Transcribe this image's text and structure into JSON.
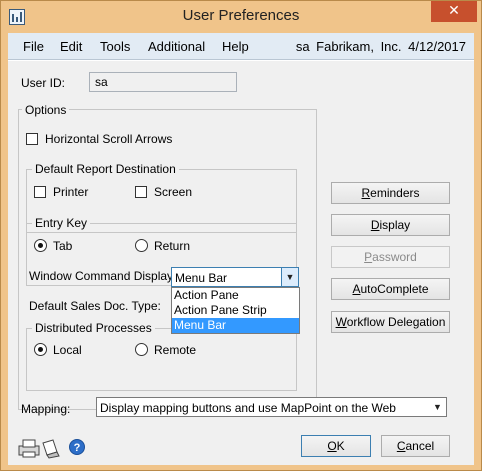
{
  "window": {
    "title": "User Preferences",
    "close_glyph": "✕",
    "icon": "app-window-icon"
  },
  "menubar": {
    "items": [
      "File",
      "Edit",
      "Tools",
      "Additional",
      "Help"
    ],
    "user": "sa",
    "company": "Fabrikam, Inc.",
    "date": "4/12/2017"
  },
  "user_id": {
    "label": "User ID:",
    "value": "sa"
  },
  "options": {
    "title": "Options",
    "horizontal_scroll": {
      "label": "Horizontal Scroll Arrows",
      "checked": false
    },
    "report_destination": {
      "title": "Default Report Destination",
      "printer": {
        "label": "Printer",
        "checked": false
      },
      "screen": {
        "label": "Screen",
        "checked": false
      }
    },
    "entry_key": {
      "title": "Entry Key",
      "tab": {
        "label": "Tab",
        "selected": true
      },
      "return": {
        "label": "Return",
        "selected": false
      }
    },
    "window_command_display": {
      "label": "Window Command Display",
      "value": "Menu Bar",
      "options": [
        "Action Pane",
        "Action Pane Strip",
        "Menu Bar"
      ],
      "selected": "Menu Bar"
    },
    "default_sales_doc_type": {
      "label": "Default Sales Doc. Type:"
    },
    "distributed_processes": {
      "title": "Distributed Processes",
      "local": {
        "label": "Local",
        "selected": true
      },
      "remote": {
        "label": "Remote",
        "selected": false
      }
    }
  },
  "side_buttons": {
    "reminders": {
      "pre": "",
      "ul": "R",
      "post": "eminders",
      "enabled": true
    },
    "display": {
      "pre": "",
      "ul": "D",
      "post": "isplay",
      "enabled": true
    },
    "password": {
      "pre": "",
      "ul": "P",
      "post": "assword",
      "enabled": false
    },
    "autocomplete": {
      "pre": "",
      "ul": "A",
      "post": "utoComplete",
      "enabled": true
    },
    "workflow_delegation": {
      "pre": "",
      "ul": "W",
      "post": "orkflow Delegation",
      "enabled": true
    }
  },
  "mapping": {
    "label": "Mapping:",
    "value": "Display mapping buttons and use MapPoint on the Web"
  },
  "footer": {
    "ok": {
      "ul": "O",
      "post": "K"
    },
    "cancel": {
      "ul": "C",
      "post": "ancel"
    },
    "help_glyph": "?"
  },
  "colors": {
    "titlebar": "#f0c48a",
    "menubar": "#e2ebf4",
    "selection": "#3399ff",
    "close": "#c7502d"
  }
}
